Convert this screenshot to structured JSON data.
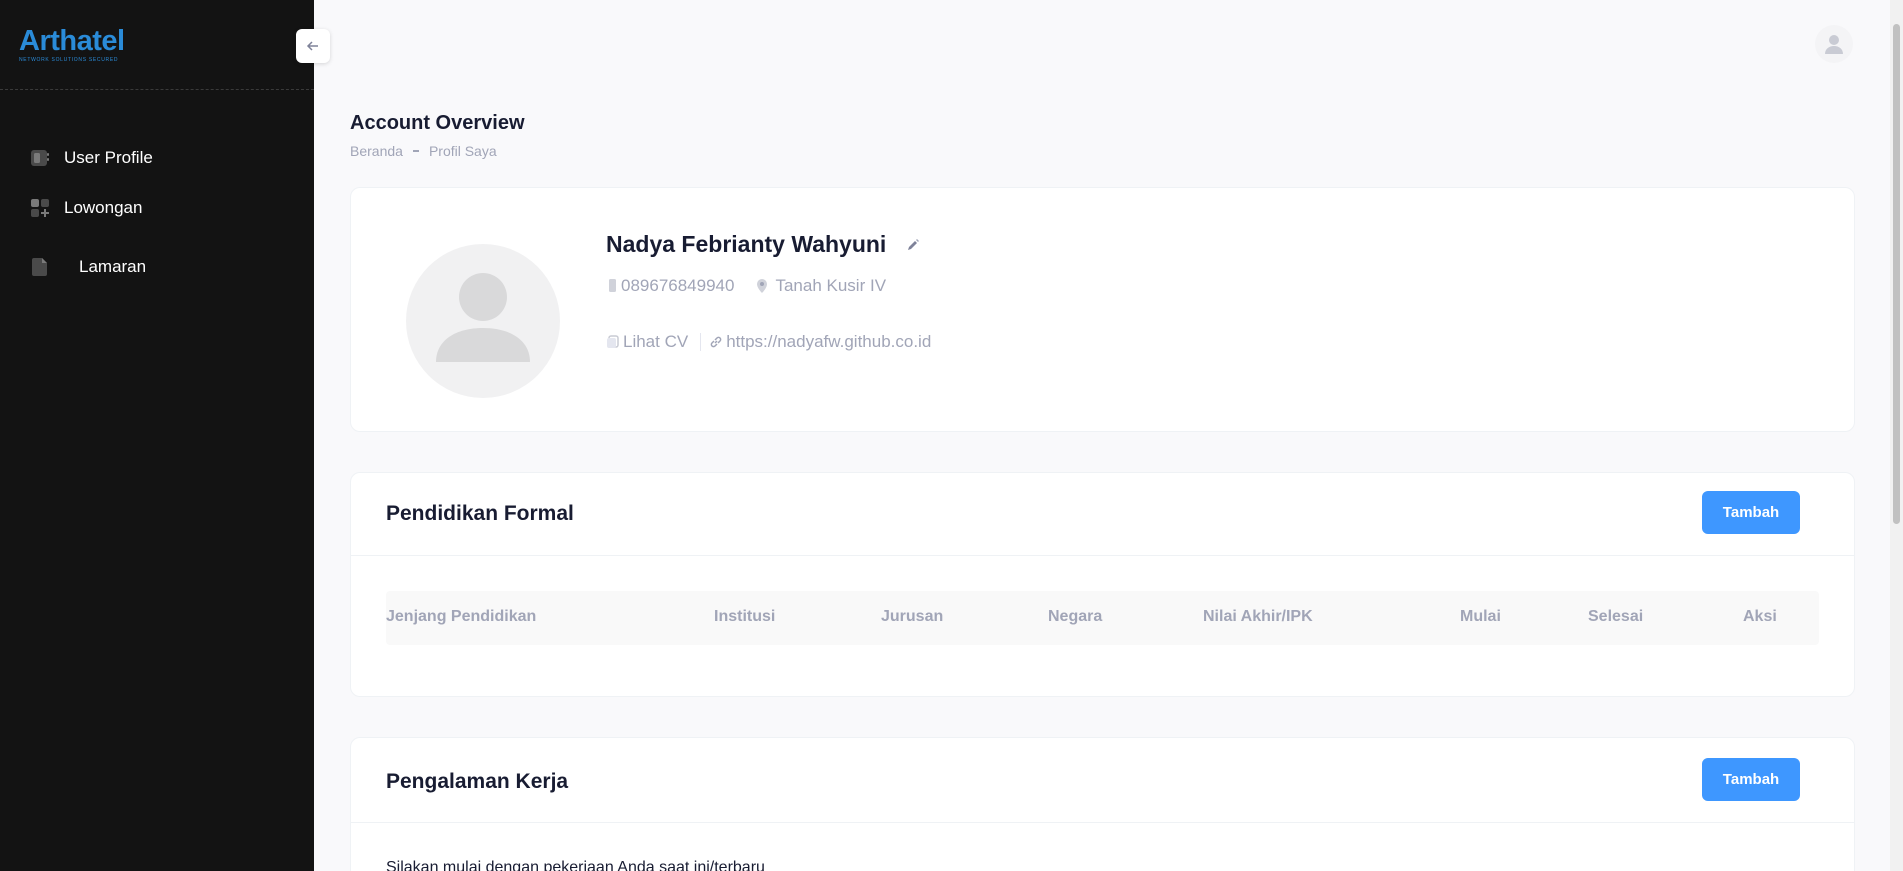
{
  "brand": {
    "name": "Arthatel",
    "tagline": "NETWORK SOLUTIONS SECURED"
  },
  "sidebar": {
    "items": [
      {
        "label": "User Profile",
        "icon": "user-profile-icon"
      },
      {
        "label": "Lowongan",
        "icon": "grid-plus-icon"
      },
      {
        "label": "Lamaran",
        "icon": "document-icon"
      }
    ],
    "toggle_icon": "arrow-left-icon"
  },
  "header": {
    "avatar_icon": "user-avatar-icon"
  },
  "page": {
    "title": "Account Overview",
    "breadcrumb": [
      "Beranda",
      "Profil Saya"
    ]
  },
  "profile": {
    "name": "Nadya Febrianty Wahyuni",
    "phone": "089676849940",
    "location": "Tanah Kusir IV",
    "cv_label": "Lihat CV",
    "website": "https://nadyafw.github.co.id"
  },
  "education": {
    "title": "Pendidikan Formal",
    "add_label": "Tambah",
    "columns": [
      "Jenjang Pendidikan",
      "Institusi",
      "Jurusan",
      "Negara",
      "Nilai Akhir/IPK",
      "Mulai",
      "Selesai",
      "Aksi"
    ]
  },
  "work": {
    "title": "Pengalaman Kerja",
    "add_label": "Tambah",
    "hint": "Silakan mulai dengan pekerjaan Anda saat ini/terbaru"
  },
  "colors": {
    "sidebar_bg": "#131313",
    "brand": "#2a8bd8",
    "primary_button": "#3e97ff",
    "page_bg": "#f9f9fb"
  }
}
